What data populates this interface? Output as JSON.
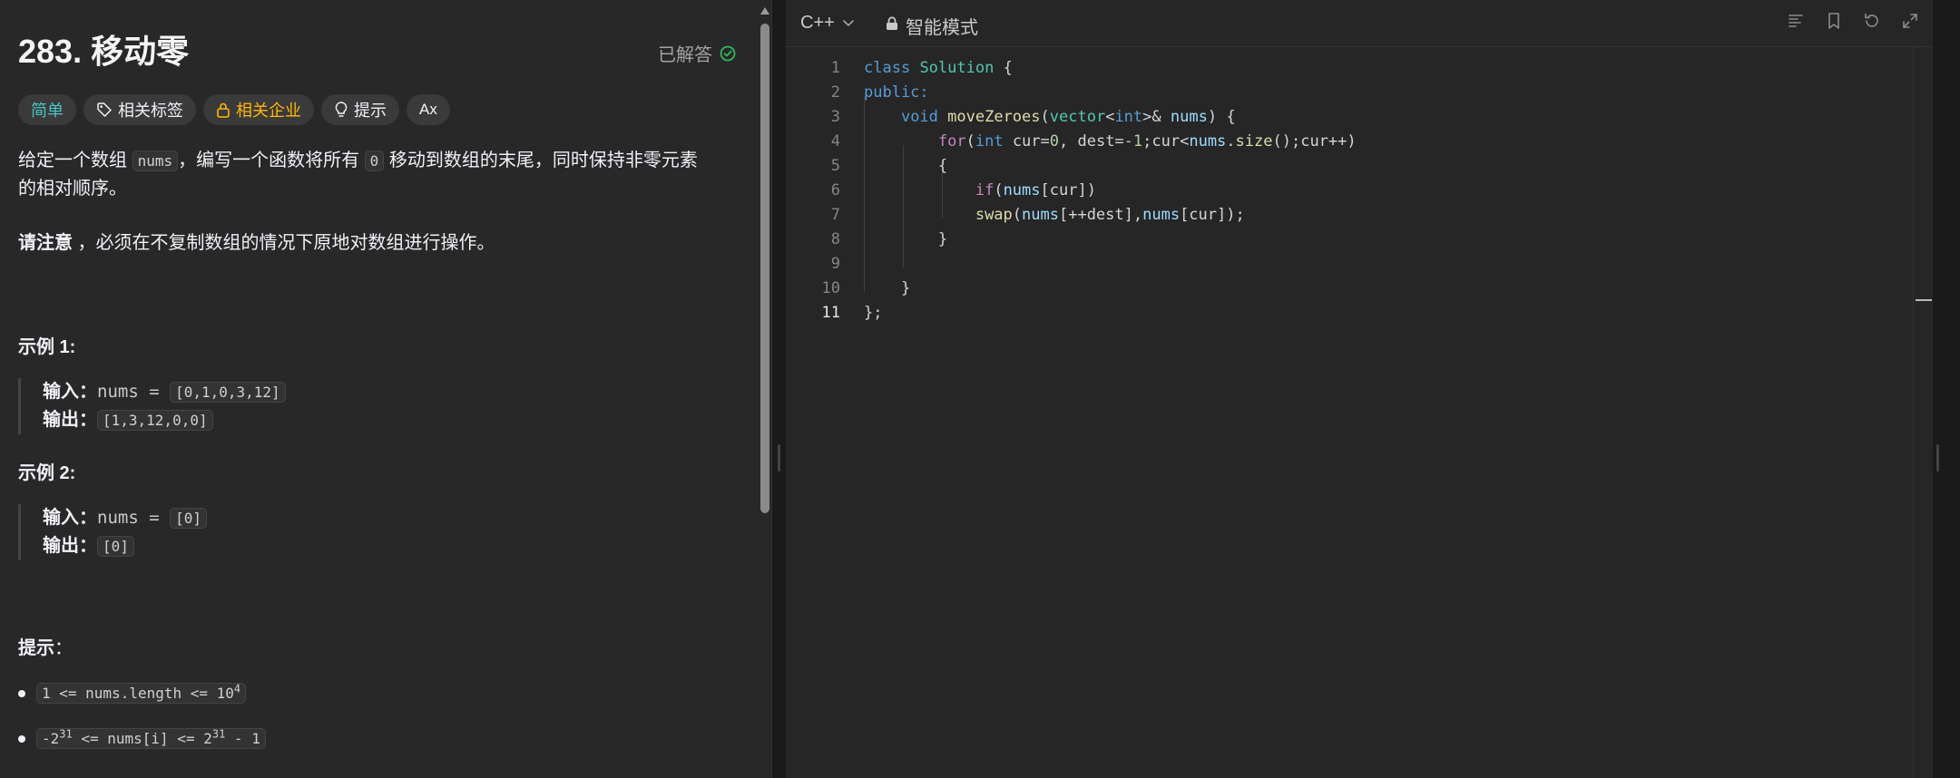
{
  "problem": {
    "title": "283. 移动零",
    "status": "已解答",
    "tags": [
      {
        "label": "简单"
      },
      {
        "label": "相关标签"
      },
      {
        "label": "相关企业"
      },
      {
        "label": "提示"
      },
      {
        "label": "Ax"
      }
    ],
    "description": {
      "p1_a": "给定一个数组 ",
      "p1_code1": "nums",
      "p1_b": "，编写一个函数将所有 ",
      "p1_code2": "0",
      "p1_c": " 移动到数组的末尾，同时保持非零元素",
      "p1_d": "的相对顺序。",
      "p2_bold": "请注意",
      "p2_rest": " ，必须在不复制数组的情况下原地对数组进行操作。"
    },
    "examples": [
      {
        "heading": "示例 1:",
        "input_label": "输入：",
        "input_var": "nums = ",
        "input_val": "[0,1,0,3,12]",
        "output_label": "输出：",
        "output_val": "[1,3,12,0,0]"
      },
      {
        "heading": "示例 2:",
        "input_label": "输入：",
        "input_var": "nums = ",
        "input_val": "[0]",
        "output_label": "输出：",
        "output_val": "[0]"
      }
    ],
    "tips_heading": "提示",
    "tips_colon": "：",
    "tips": [
      {
        "a": "1 <= nums.length <= 10",
        "sup": "4"
      },
      {
        "a": "-2",
        "sup1": "31",
        "b": " <= nums[i] <= 2",
        "sup2": "31",
        "c": " - 1"
      }
    ]
  },
  "editor": {
    "language": "C++",
    "mode": "智能模式",
    "line_numbers": [
      "1",
      "2",
      "3",
      "4",
      "5",
      "6",
      "7",
      "8",
      "9",
      "10",
      "11"
    ],
    "active_line": "11",
    "code": {
      "l1_kw": "class",
      "l1_name": "Solution",
      "l1_rest": " {",
      "l2_kw": "public:",
      "l3_kw": "void",
      "l3_fn": "moveZeroes",
      "l3_p1": "(",
      "l3_ty": "vector",
      "l3_lt": "<",
      "l3_int": "int",
      "l3_gt": ">&",
      "l3_var": "nums",
      "l3_rest": ") {",
      "l4_for": "for",
      "l4_p": "(",
      "l4_int": "int",
      "l4_a": " cur=",
      "l4_n0": "0",
      "l4_b": ", dest=",
      "l4_n1": "-1",
      "l4_c": ";cur<",
      "l4_nums": "nums",
      "l4_dot": ".",
      "l4_size": "size",
      "l4_d": "();cur++)",
      "l5": "{",
      "l6_if": "if",
      "l6_p": "(",
      "l6_nums": "nums",
      "l6_rest": "[cur])",
      "l7_fn": "swap",
      "l7_p": "(",
      "l7_nums1": "nums",
      "l7_mid": "[++dest],",
      "l7_nums2": "nums",
      "l7_rest": "[cur]);",
      "l8": "}",
      "l9": "",
      "l10": "}",
      "l11": "};"
    }
  }
}
